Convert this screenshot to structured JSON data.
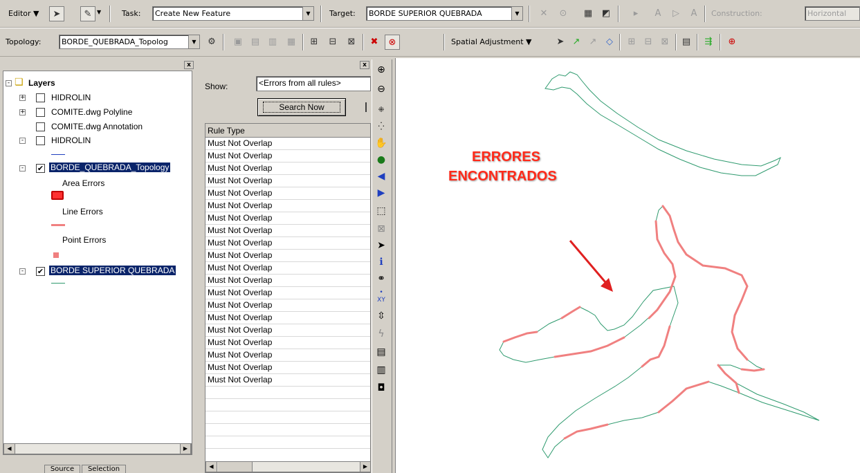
{
  "editor_toolbar": {
    "editor_label": "Editor",
    "task_label": "Task:",
    "task_value": "Create New Feature",
    "target_label": "Target:",
    "target_value": "BORDE SUPERIOR QUEBRADA",
    "construction_label": "Construction:",
    "construction_value": "Horizontal"
  },
  "topology_toolbar": {
    "topology_label": "Topology:",
    "topology_value": "BORDE_QUEBRADA_Topolog",
    "spatial_adjustment_label": "Spatial Adjustment"
  },
  "toc": {
    "root_label": "Layers",
    "layers": [
      {
        "label": "HIDROLIN",
        "checked": false,
        "expander": "+"
      },
      {
        "label": "COMITE.dwg Polyline",
        "checked": false,
        "expander": "+"
      },
      {
        "label": "COMITE.dwg Annotation",
        "checked": false,
        "expander": ""
      },
      {
        "label": "HIDROLIN",
        "checked": false,
        "expander": "-"
      },
      {
        "label": "BORDE_QUEBRADA_Topology",
        "checked": true,
        "expander": "-"
      },
      {
        "label": "BORDE SUPERIOR QUEBRADA",
        "checked": true,
        "expander": "-"
      }
    ],
    "legend": {
      "area_errors": "Area Errors",
      "line_errors": "Line Errors",
      "point_errors": "Point Errors"
    },
    "tabs": [
      "Source",
      "Selection"
    ]
  },
  "error_inspector": {
    "show_label": "Show:",
    "show_value": "<Errors from all rules>",
    "search_button": "Search Now",
    "column_header": "Rule Type",
    "rows": [
      "Must Not Overlap",
      "Must Not Overlap",
      "Must Not Overlap",
      "Must Not Overlap",
      "Must Not Overlap",
      "Must Not Overlap",
      "Must Not Overlap",
      "Must Not Overlap",
      "Must Not Overlap",
      "Must Not Overlap",
      "Must Not Overlap",
      "Must Not Overlap",
      "Must Not Overlap",
      "Must Not Overlap",
      "Must Not Overlap",
      "Must Not Overlap",
      "Must Not Overlap",
      "Must Not Overlap",
      "Must Not Overlap",
      "Must Not Overlap"
    ]
  },
  "map": {
    "annotation_line1": "ERRORES",
    "annotation_line2": "ENCONTRADOS",
    "colors": {
      "feature_line": "#2e9a6e",
      "error_line": "#f08080",
      "annotation": "#ff2a1a"
    }
  }
}
